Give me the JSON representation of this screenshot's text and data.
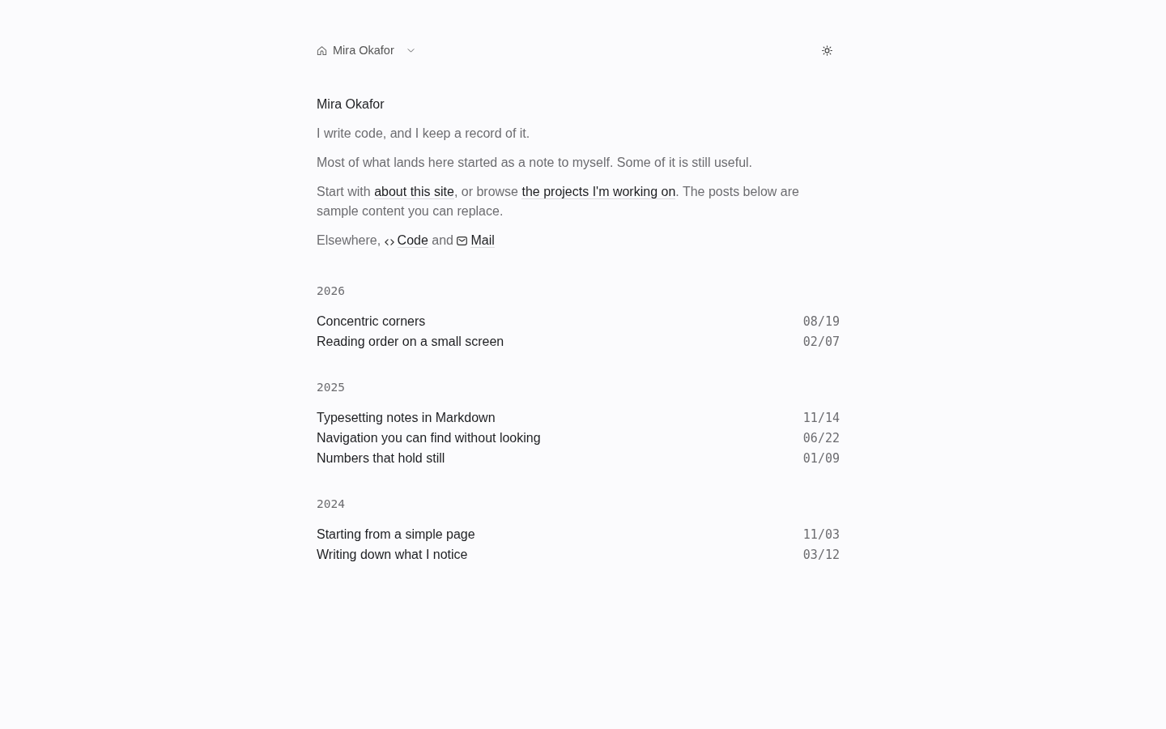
{
  "nav": {
    "site_name": "Mira Okafor"
  },
  "intro": {
    "name": "Mira Okafor",
    "paragraphs": [
      [
        {
          "kind": "text",
          "text": "I write code, and I keep a record of it."
        }
      ],
      [
        {
          "kind": "text",
          "text": "Most of what lands here started as a note to myself. Some of it is still useful."
        }
      ],
      [
        {
          "kind": "text",
          "text": "Start with "
        },
        {
          "kind": "link",
          "text": "about this site"
        },
        {
          "kind": "text",
          "text": ", or browse "
        },
        {
          "kind": "link",
          "text": "the projects I'm working on"
        },
        {
          "kind": "text",
          "text": ". The posts below are sample content you can replace."
        }
      ],
      [
        {
          "kind": "text",
          "text": "Elsewhere, "
        },
        {
          "kind": "code",
          "text": "Code"
        },
        {
          "kind": "text",
          "text": " and "
        },
        {
          "kind": "mail",
          "text": "Mail"
        }
      ]
    ]
  },
  "years": [
    {
      "year": "2026",
      "posts": [
        {
          "title": "Concentric corners",
          "date": "08/19"
        },
        {
          "title": "Reading order on a small screen",
          "date": "02/07"
        }
      ]
    },
    {
      "year": "2025",
      "posts": [
        {
          "title": "Typesetting notes in Markdown",
          "date": "11/14"
        },
        {
          "title": "Navigation you can find without looking",
          "date": "06/22"
        },
        {
          "title": "Numbers that hold still",
          "date": "01/09"
        }
      ]
    },
    {
      "year": "2024",
      "posts": [
        {
          "title": "Starting from a simple page",
          "date": "11/03"
        },
        {
          "title": "Writing down what I notice",
          "date": "03/12"
        }
      ]
    }
  ]
}
